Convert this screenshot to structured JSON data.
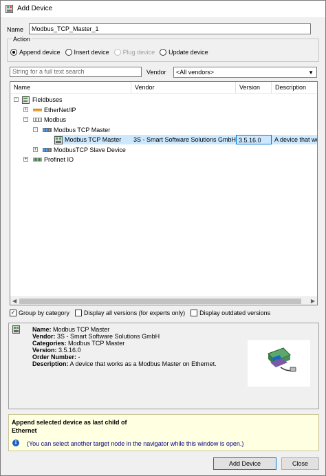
{
  "window": {
    "title": "Add Device"
  },
  "name": {
    "label": "Name",
    "value": "Modbus_TCP_Master_1"
  },
  "action": {
    "legend": "Action",
    "options": [
      {
        "label": "Append device",
        "checked": true,
        "disabled": false
      },
      {
        "label": "Insert device",
        "checked": false,
        "disabled": false
      },
      {
        "label": "Plug device",
        "checked": false,
        "disabled": true
      },
      {
        "label": "Update device",
        "checked": false,
        "disabled": false
      }
    ]
  },
  "search": {
    "placeholder": "String for a full text search"
  },
  "vendor": {
    "label": "Vendor",
    "selected": "<All vendors>"
  },
  "tree": {
    "columns": [
      "Name",
      "Vendor",
      "Version",
      "Description"
    ],
    "rows": [
      {
        "name": "Fieldbuses",
        "icon": "fieldbus-icon",
        "expander": "-"
      },
      {
        "name": "EtherNet/IP",
        "icon": "ethernet-ip-icon",
        "expander": "+"
      },
      {
        "name": "Modbus",
        "icon": "modbus-icon",
        "expander": "-"
      },
      {
        "name": "Modbus TCP Master",
        "icon": "modbus-master-icon",
        "expander": "-"
      },
      {
        "name": "Modbus TCP Master",
        "icon": "device-icon",
        "vendor": "3S - Smart Software Solutions GmbH",
        "version": "3.5.16.0",
        "description": "A device that wo",
        "selected": true
      },
      {
        "name": "ModbusTCP Slave Device",
        "icon": "modbus-slave-icon",
        "expander": "+"
      },
      {
        "name": "Profinet IO",
        "icon": "profinet-icon",
        "expander": "+"
      }
    ]
  },
  "options": {
    "group_by_category": {
      "label": "Group by category",
      "checked": true
    },
    "all_versions": {
      "label": "Display all versions (for experts only)",
      "checked": false
    },
    "outdated_versions": {
      "label": "Display outdated versions",
      "checked": false
    }
  },
  "info": {
    "name_label": "Name:",
    "name_value": "Modbus TCP Master",
    "vendor_label": "Vendor:",
    "vendor_value": "3S - Smart Software Solutions GmbH",
    "categories_label": "Categories:",
    "categories_value": "Modbus TCP Master",
    "version_label": "Version:",
    "version_value": "3.5.16.0",
    "order_label": "Order Number:",
    "order_value": "-",
    "description_label": "Description:",
    "description_value": "A device that works as a Modbus Master on Ethernet."
  },
  "append_info": {
    "line1": "Append selected device as last child of",
    "line2": "Ethernet",
    "note": "(You can select another target node in the navigator while this window is open.)"
  },
  "buttons": {
    "add_device": "Add Device",
    "close": "Close"
  }
}
